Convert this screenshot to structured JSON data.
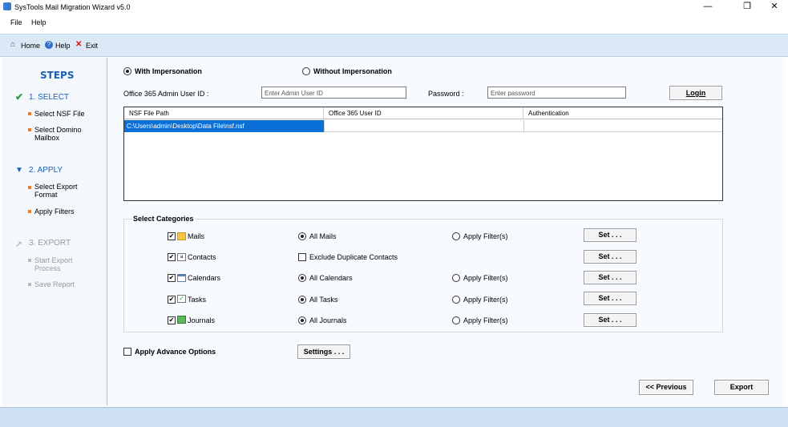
{
  "window": {
    "title": "SysTools Mail Migration Wizard v5.0",
    "minimize": "—",
    "restore": "❐",
    "close": "✕"
  },
  "menu": {
    "file": "File",
    "help": "Help"
  },
  "toolbar": {
    "home": "Home",
    "help": "Help",
    "exit": "Exit"
  },
  "steps": {
    "title": "STEPS",
    "step1": {
      "label": "1. SELECT",
      "items": [
        "Select NSF File",
        "Select Domino\nMailbox"
      ]
    },
    "step2": {
      "label": "2. APPLY",
      "items": [
        "Select Export\nFormat",
        "Apply Filters"
      ]
    },
    "step3": {
      "label": "3. EXPORT",
      "items": [
        "Start Export\nProcess",
        "Save Report"
      ]
    }
  },
  "impersonation": {
    "with": "With Impersonation",
    "without": "Without Impersonation",
    "selected": "with"
  },
  "admin": {
    "label": "Office 365 Admin User ID :",
    "placeholder": "Enter Admin User ID",
    "password_label": "Password :",
    "password_placeholder": "Enter password",
    "login": "Login"
  },
  "grid": {
    "headers": [
      "NSF File Path",
      "Office 365 User ID",
      "Authentication"
    ],
    "rows": [
      [
        "C:\\Users\\admin\\Desktop\\Data File\\nsf.nsf",
        "",
        ""
      ]
    ]
  },
  "categories": {
    "title": "Select Categories",
    "items": [
      {
        "name": "Mails",
        "checked": true,
        "option": "All Mails",
        "option_type": "radio",
        "filter": "Apply Filter(s)",
        "set": "Set . . ."
      },
      {
        "name": "Contacts",
        "checked": true,
        "option": "Exclude Duplicate Contacts",
        "option_type": "checkbox",
        "filter": "",
        "set": "Set . . ."
      },
      {
        "name": "Calendars",
        "checked": true,
        "option": "All Calendars",
        "option_type": "radio",
        "filter": "Apply Filter(s)",
        "set": "Set . . ."
      },
      {
        "name": "Tasks",
        "checked": true,
        "option": "All Tasks",
        "option_type": "radio",
        "filter": "Apply Filter(s)",
        "set": "Set . . ."
      },
      {
        "name": "Journals",
        "checked": true,
        "option": "All Journals",
        "option_type": "radio",
        "filter": "Apply Filter(s)",
        "set": "Set . . ."
      }
    ]
  },
  "advance": {
    "label": "Apply Advance Options",
    "settings": "Settings . . ."
  },
  "nav": {
    "previous": "<< Previous",
    "export": "Export"
  },
  "colors": {
    "accent": "#1a5fb4",
    "toolbar": "#dbe8f6",
    "selection": "#0a6fd6",
    "check": "#2e9e3a"
  }
}
